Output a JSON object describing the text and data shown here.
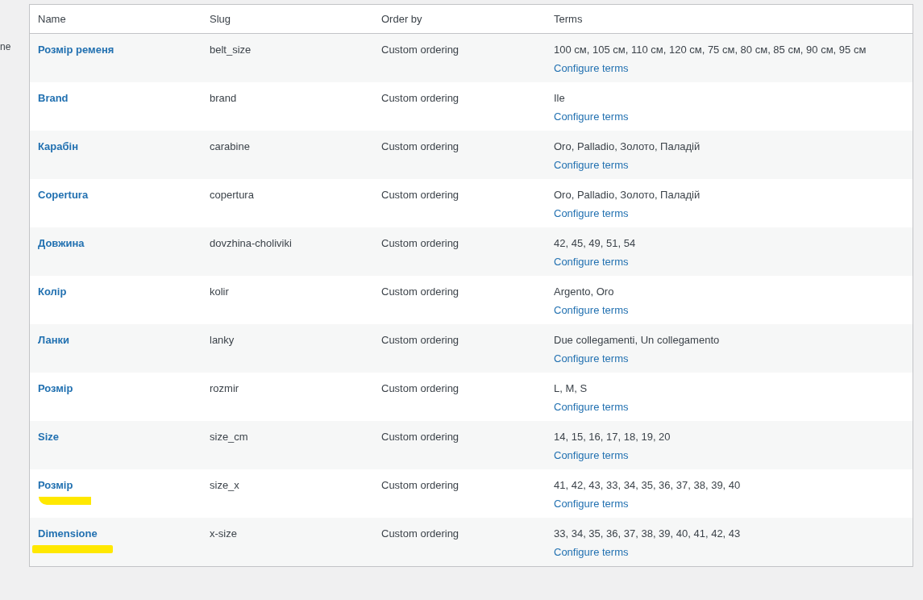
{
  "side_text": "ne",
  "table": {
    "columns": [
      "Name",
      "Slug",
      "Order by",
      "Terms"
    ],
    "rows": [
      {
        "name": "Розмір ременя",
        "slug": "belt_size",
        "order_by": "Custom ordering",
        "terms": "100 см, 105 см, 110 см, 120 см, 75 см, 80 см, 85 см, 90 см, 95 см",
        "action": "Configure terms",
        "highlighted": false
      },
      {
        "name": "Brand",
        "slug": "brand",
        "order_by": "Custom ordering",
        "terms": "Ile",
        "action": "Configure terms",
        "highlighted": false
      },
      {
        "name": "Карабін",
        "slug": "carabine",
        "order_by": "Custom ordering",
        "terms": "Oro, Palladio, Золото, Паладій",
        "action": "Configure terms",
        "highlighted": false
      },
      {
        "name": "Copertura",
        "slug": "copertura",
        "order_by": "Custom ordering",
        "terms": "Oro, Palladio, Золото, Паладій",
        "action": "Configure terms",
        "highlighted": false
      },
      {
        "name": "Довжина",
        "slug": "dovzhina-choliviki",
        "order_by": "Custom ordering",
        "terms": "42, 45, 49, 51, 54",
        "action": "Configure terms",
        "highlighted": false
      },
      {
        "name": "Колір",
        "slug": "kolir",
        "order_by": "Custom ordering",
        "terms": "Argento, Oro",
        "action": "Configure terms",
        "highlighted": false
      },
      {
        "name": "Ланки",
        "slug": "lanky",
        "order_by": "Custom ordering",
        "terms": "Due collegamenti, Un collegamento",
        "action": "Configure terms",
        "highlighted": false
      },
      {
        "name": "Розмір",
        "slug": "rozmir",
        "order_by": "Custom ordering",
        "terms": "L, M, S",
        "action": "Configure terms",
        "highlighted": false
      },
      {
        "name": "Size",
        "slug": "size_cm",
        "order_by": "Custom ordering",
        "terms": "14, 15, 16, 17, 18, 19, 20",
        "action": "Configure terms",
        "highlighted": false
      },
      {
        "name": "Розмір",
        "slug": "size_x",
        "order_by": "Custom ordering",
        "terms": "41, 42, 43, 33, 34, 35, 36, 37, 38, 39, 40",
        "action": "Configure terms",
        "highlighted": true
      },
      {
        "name": "Dimensione",
        "slug": "x-size",
        "order_by": "Custom ordering",
        "terms": "33, 34, 35, 36, 37, 38, 39, 40, 41, 42, 43",
        "action": "Configure terms",
        "highlighted": true
      }
    ]
  }
}
